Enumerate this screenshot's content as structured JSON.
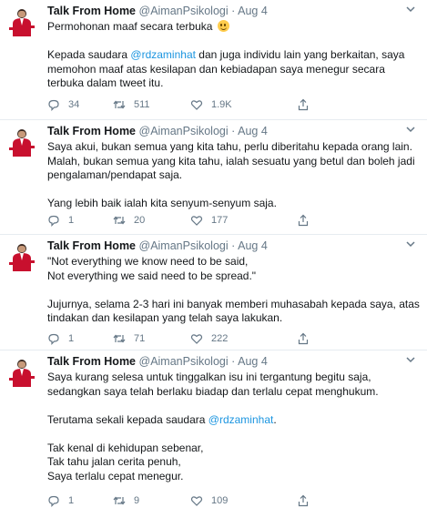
{
  "tweets": [
    {
      "name": "Talk From Home",
      "handle": "@AimanPsikologi",
      "sep": "·",
      "date": "Aug 4",
      "lines": [
        "Permohonan maaf secara terbuka",
        "",
        [
          "Kepada saudara ",
          "@rdzaminhat",
          " dan juga individu lain yang berkaitan, saya"
        ],
        "memohon maaf atas kesilapan dan kebiadapan saya menegur secara",
        "terbuka dalam tweet itu."
      ],
      "replies": "34",
      "retweets": "511",
      "likes": "1.9K"
    },
    {
      "name": "Talk From Home",
      "handle": "@AimanPsikologi",
      "sep": "·",
      "date": "Aug 4",
      "lines": [
        "Saya akui, bukan semua yang kita tahu, perlu diberitahu kepada orang lain.",
        "Malah, bukan semua yang kita tahu, ialah sesuatu yang betul dan boleh jadi",
        "pengalaman/pendapat saja.",
        "",
        "Yang lebih baik ialah kita senyum-senyum saja."
      ],
      "replies": "1",
      "retweets": "20",
      "likes": "177"
    },
    {
      "name": "Talk From Home",
      "handle": "@AimanPsikologi",
      "sep": "·",
      "date": "Aug 4",
      "lines": [
        "\"Not everything we know need to be said,",
        "Not everything we said need to be spread.\"",
        "",
        "Jujurnya, selama 2-3 hari ini banyak memberi muhasabah kepada saya, atas",
        "tindakan dan kesilapan yang telah saya lakukan."
      ],
      "replies": "1",
      "retweets": "71",
      "likes": "222"
    },
    {
      "name": "Talk From Home",
      "handle": "@AimanPsikologi",
      "sep": "·",
      "date": "Aug 4",
      "lines": [
        "Saya kurang selesa untuk tinggalkan isu ini tergantung begitu saja,",
        "sedangkan saya telah berlaku biadap dan terlalu cepat menghukum.",
        "",
        [
          "Terutama sekali kepada saudara ",
          "@rdzaminhat",
          "."
        ],
        "",
        "Tak kenal di kehidupan sebenar,",
        "Tak tahu jalan cerita penuh,",
        "Saya terlalu cepat menegur."
      ],
      "replies": "1",
      "retweets": "9",
      "likes": "109"
    }
  ],
  "icons": {
    "reply": "reply-icon",
    "retweet": "retweet-icon",
    "like": "heart-icon",
    "share": "share-icon",
    "more": "chevron-down-icon"
  },
  "colors": {
    "name": "#14171a",
    "meta": "#657786",
    "mention": "#1b95e0",
    "divider": "#e6ecf0",
    "emoji": "#ffcc4d"
  }
}
